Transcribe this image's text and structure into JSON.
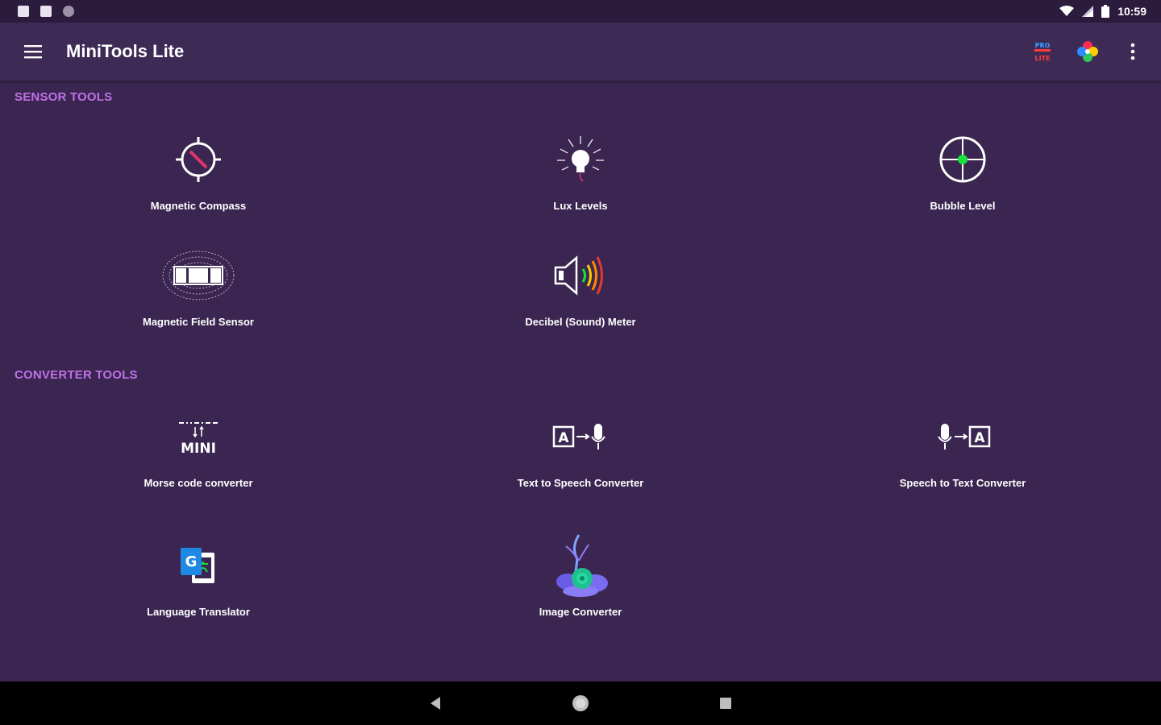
{
  "status_bar": {
    "time": "10:59"
  },
  "app_bar": {
    "title": "MiniTools Lite",
    "pro_badge_top": "PRO",
    "pro_badge_bottom": "LITE"
  },
  "sections": [
    {
      "title": "SENSOR TOOLS",
      "items": [
        {
          "label": "Magnetic Compass",
          "icon": "compass-icon"
        },
        {
          "label": "Lux Levels",
          "icon": "lightbulb-icon"
        },
        {
          "label": "Bubble Level",
          "icon": "bubble-level-icon"
        },
        {
          "label": "Magnetic Field Sensor",
          "icon": "magnet-icon"
        },
        {
          "label": "Decibel (Sound) Meter",
          "icon": "speaker-icon"
        }
      ]
    },
    {
      "title": "CONVERTER TOOLS",
      "items": [
        {
          "label": "Morse code converter",
          "icon": "morse-icon",
          "icon_text": "MINI"
        },
        {
          "label": "Text to Speech Converter",
          "icon": "text-to-speech-icon",
          "icon_letter": "A"
        },
        {
          "label": "Speech to Text Converter",
          "icon": "speech-to-text-icon",
          "icon_letter": "A"
        },
        {
          "label": "Language Translator",
          "icon": "translate-icon",
          "icon_letter": "G"
        },
        {
          "label": "Image Converter",
          "icon": "image-icon"
        }
      ]
    }
  ],
  "colors": {
    "background": "#3a2650",
    "app_bar": "#3d2a55",
    "section_title": "#c170e8"
  }
}
